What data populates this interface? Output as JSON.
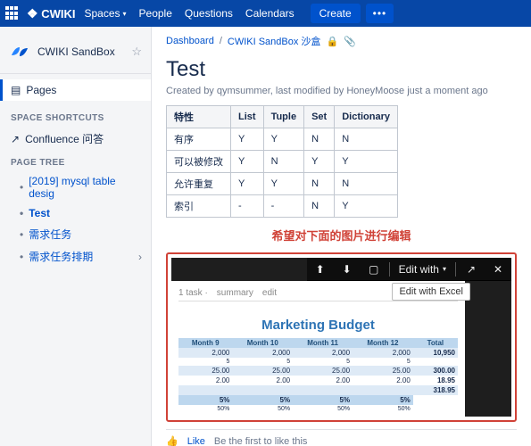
{
  "nav": {
    "brand": "CWIKI",
    "items": [
      "Spaces",
      "People",
      "Questions",
      "Calendars"
    ],
    "create": "Create",
    "more": "•••"
  },
  "sidebar": {
    "space_name": "CWIKI SandBox",
    "pages_label": "Pages",
    "shortcuts_hdr": "SPACE SHORTCUTS",
    "shortcut1": "Confluence 问答",
    "tree_hdr": "PAGE TREE",
    "tree": [
      {
        "label": "[2019] mysql table desig"
      },
      {
        "label": "Test"
      },
      {
        "label": "需求任务"
      },
      {
        "label": "需求任务排期"
      }
    ]
  },
  "crumbs": {
    "dashboard": "Dashboard",
    "space": "CWIKI SandBox 沙盒"
  },
  "page": {
    "title": "Test",
    "byline": "Created by qymsummer, last modified by HoneyMoose just a moment ago"
  },
  "table": {
    "headers": [
      "特性",
      "List",
      "Tuple",
      "Set",
      "Dictionary"
    ],
    "rows": [
      [
        "有序",
        "Y",
        "Y",
        "N",
        "N"
      ],
      [
        "可以被修改",
        "Y",
        "N",
        "Y",
        "Y"
      ],
      [
        "允许重复",
        "Y",
        "Y",
        "N",
        "N"
      ],
      [
        "索引",
        "-",
        "-",
        "N",
        "Y"
      ]
    ]
  },
  "banner": "希望对下面的图片进行编辑",
  "embed": {
    "edit_with": "Edit with",
    "edit_with_excel": "Edit with Excel",
    "doc_title": "Marketing Budget",
    "tabs": [
      "1 task ·",
      "summary",
      "edit"
    ],
    "xl_headers": [
      "Month 9",
      "Month 10",
      "Month 11",
      "Month 12",
      "Total"
    ],
    "xl_rows": [
      [
        "2,000",
        "2,000",
        "2,000",
        "2,000",
        "10,950"
      ],
      [
        "5",
        "5",
        "5",
        "5",
        ""
      ],
      [
        "25.00",
        "25.00",
        "25.00",
        "25.00",
        "300.00"
      ],
      [
        "2.00",
        "2.00",
        "2.00",
        "2.00",
        "18.95"
      ],
      [
        "",
        "",
        "",
        "",
        "318.95"
      ],
      [
        "5%",
        "5%",
        "5%",
        "5%",
        ""
      ],
      [
        "50%",
        "50%",
        "50%",
        "50%",
        ""
      ]
    ]
  },
  "like": {
    "like": "Like",
    "first": "Be the first to like this"
  }
}
